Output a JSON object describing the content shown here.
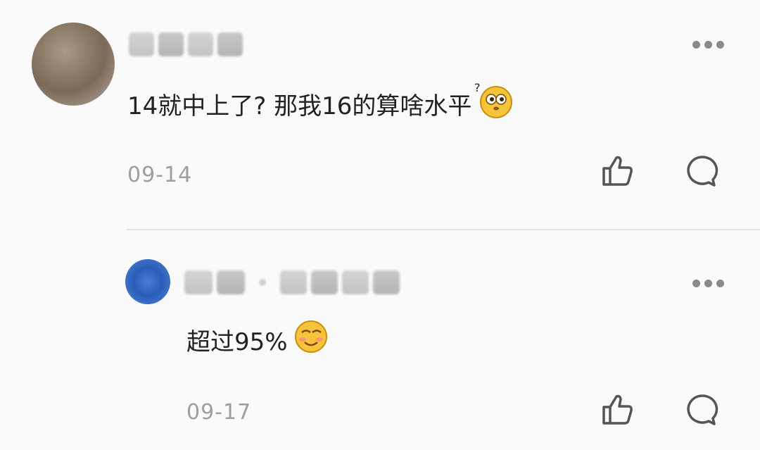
{
  "comments": [
    {
      "text": "14就中上了? 那我16的算啥水平",
      "emoji": "confused-face-emoji",
      "date": "09-14",
      "icons": {
        "like": "thumbs-up-icon",
        "reply": "comment-bubble-icon",
        "more": "more-dots-icon"
      }
    },
    {
      "text": "超过95%",
      "emoji": "smug-face-emoji",
      "date": "09-17",
      "icons": {
        "like": "thumbs-up-icon",
        "reply": "comment-bubble-icon",
        "more": "more-dots-icon"
      }
    }
  ]
}
